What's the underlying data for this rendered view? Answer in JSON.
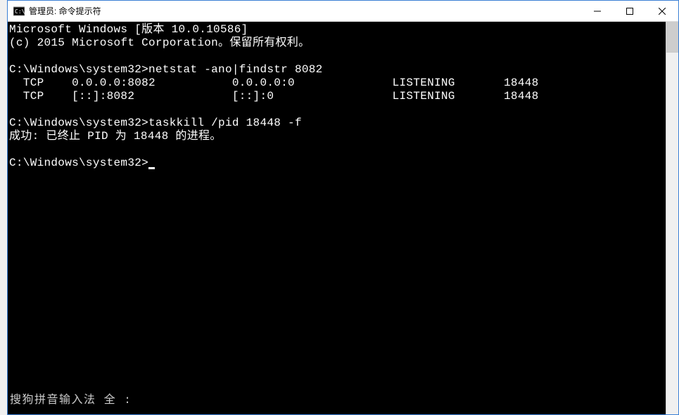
{
  "window": {
    "title": "管理员: 命令提示符"
  },
  "terminal": {
    "banner_line1": "Microsoft Windows [版本 10.0.10586]",
    "banner_line2": "(c) 2015 Microsoft Corporation。保留所有权利。",
    "prompt1_path": "C:\\Windows\\system32>",
    "prompt1_command": "netstat -ano|findstr 8082",
    "netstat_row1": "  TCP    0.0.0.0:8082           0.0.0.0:0              LISTENING       18448",
    "netstat_row2": "  TCP    [::]:8082              [::]:0                 LISTENING       18448",
    "prompt2_path": "C:\\Windows\\system32>",
    "prompt2_command": "taskkill /pid 18448 -f",
    "taskkill_result": "成功: 已终止 PID 为 18448 的进程。",
    "prompt3_path": "C:\\Windows\\system32>"
  },
  "ime": {
    "status": "搜狗拼音输入法 全 :"
  }
}
